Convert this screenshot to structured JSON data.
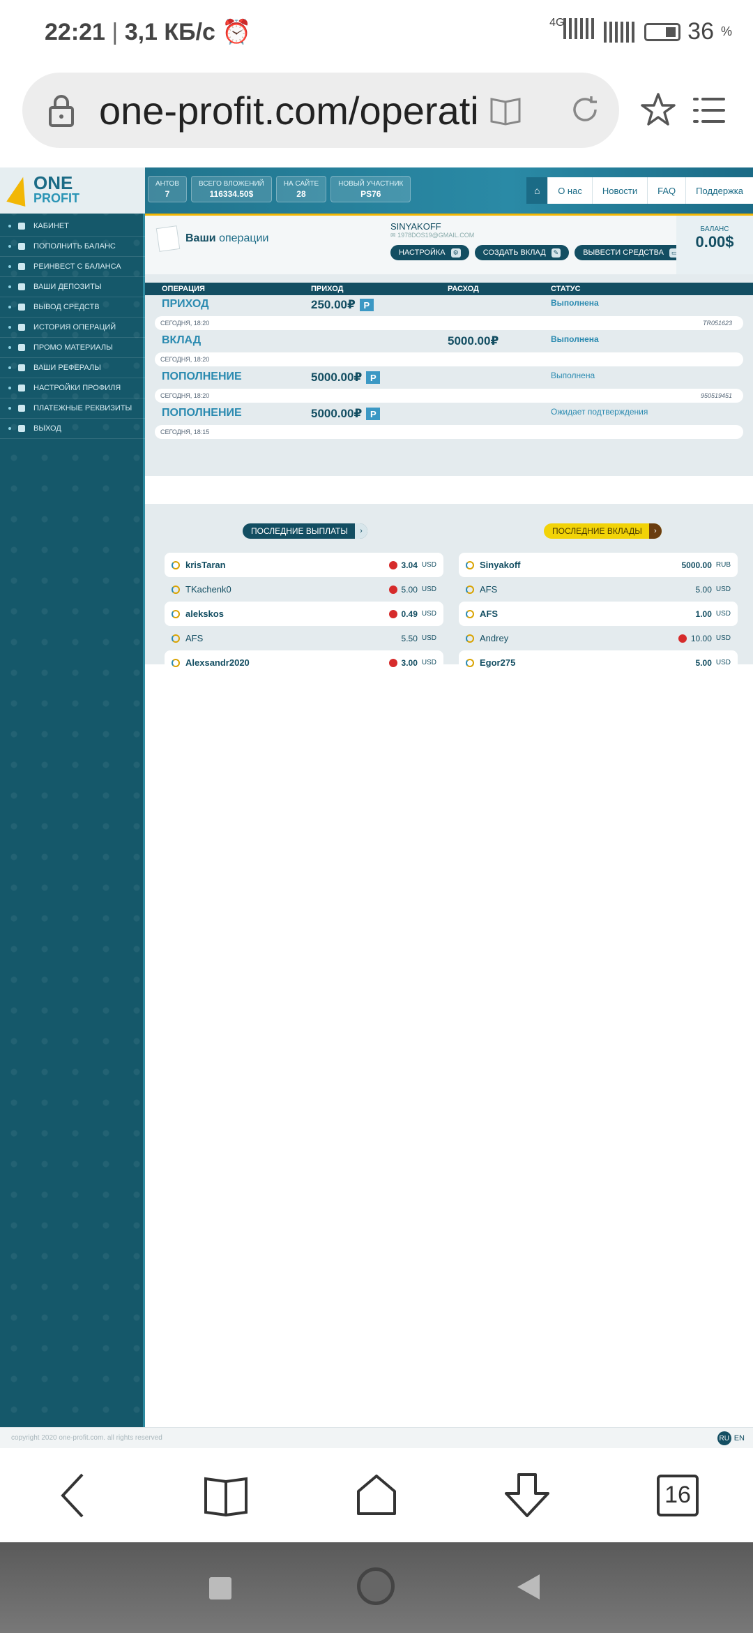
{
  "status_bar": {
    "time": "22:21",
    "speed": "3,1 КБ/с",
    "network": "4G",
    "battery": "36",
    "battery_unit": "%"
  },
  "browser": {
    "url": "one-profit.com/operati",
    "tabs_count": "16"
  },
  "site": {
    "logo_one": "ONE",
    "logo_profit": "PROFIT",
    "stats": [
      {
        "label": "антов",
        "value": "7"
      },
      {
        "label": "Всего вложений",
        "value": "116334.50$"
      },
      {
        "label": "На сайте",
        "value": "28"
      },
      {
        "label": "Новый участник",
        "value": "PS76"
      }
    ],
    "topnav": [
      "О нас",
      "Новости",
      "FAQ",
      "Поддержка"
    ],
    "sidebar": [
      "Кабинет",
      "Пополнить баланс",
      "Реинвест с баланса",
      "Ваши депозиты",
      "Вывод средств",
      "История операций",
      "Промо материалы",
      "Ваши рефералы",
      "Настройки профиля",
      "Платежные реквизиты",
      "Выход"
    ],
    "page_title_bold": "Ваши",
    "page_title_rest": "операции",
    "user": {
      "name": "SINYAKOFF",
      "email": "1978DOS19@GMAIL.COM",
      "buttons": [
        "Настройка",
        "Создать вклад",
        "Вывести средства"
      ]
    },
    "balance": {
      "label": "Баланс",
      "value": "0.00$"
    },
    "ops_headers": [
      "Операция",
      "Приход",
      "Расход",
      "Статус"
    ],
    "operations": [
      {
        "type": "Приход",
        "income": "250.00₽",
        "expense": "",
        "status": "Выполнена",
        "status_bold": true,
        "date": "Сегодня, 18:20",
        "ref": "TR051623",
        "pay": "P"
      },
      {
        "type": "Вклад",
        "income": "",
        "expense": "5000.00₽",
        "status": "Выполнена",
        "status_bold": true,
        "date": "Сегодня, 18:20",
        "ref": "",
        "pay": ""
      },
      {
        "type": "Пополнение",
        "income": "5000.00₽",
        "expense": "",
        "status": "Выполнена",
        "status_bold": false,
        "date": "Сегодня, 18:20",
        "ref": "950519451",
        "pay": "P"
      },
      {
        "type": "Пополнение",
        "income": "5000.00₽",
        "expense": "",
        "status": "Ожидает подтверждения",
        "status_bold": false,
        "date": "Сегодня, 18:15",
        "ref": "",
        "pay": "P"
      }
    ],
    "last_payouts_label": "Последние выплаты",
    "last_deposits_label": "Последние вклады",
    "payouts": [
      {
        "name": "krisTaran",
        "amount": "3.04",
        "currency": "USD",
        "bold": true,
        "badge": true
      },
      {
        "name": "TKachenk0",
        "amount": "5.00",
        "currency": "USD",
        "bold": false,
        "badge": true
      },
      {
        "name": "alekskos",
        "amount": "0.49",
        "currency": "USD",
        "bold": true,
        "badge": true
      },
      {
        "name": "AFS",
        "amount": "5.50",
        "currency": "USD",
        "bold": false,
        "badge": false
      },
      {
        "name": "Alexsandr2020",
        "amount": "3.00",
        "currency": "USD",
        "bold": true,
        "badge": true
      }
    ],
    "deposits": [
      {
        "name": "Sinyakoff",
        "amount": "5000.00",
        "currency": "RUB",
        "bold": true,
        "badge": false
      },
      {
        "name": "AFS",
        "amount": "5.00",
        "currency": "USD",
        "bold": false,
        "badge": false
      },
      {
        "name": "AFS",
        "amount": "1.00",
        "currency": "USD",
        "bold": true,
        "badge": false
      },
      {
        "name": "Andrey",
        "amount": "10.00",
        "currency": "USD",
        "bold": false,
        "badge": true
      },
      {
        "name": "Egor275",
        "amount": "5.00",
        "currency": "USD",
        "bold": true,
        "badge": false
      }
    ],
    "footer_copy": "copyright 2020 one-profit.com. all rights reserved",
    "lang_ru": "RU",
    "lang_en": "EN"
  }
}
